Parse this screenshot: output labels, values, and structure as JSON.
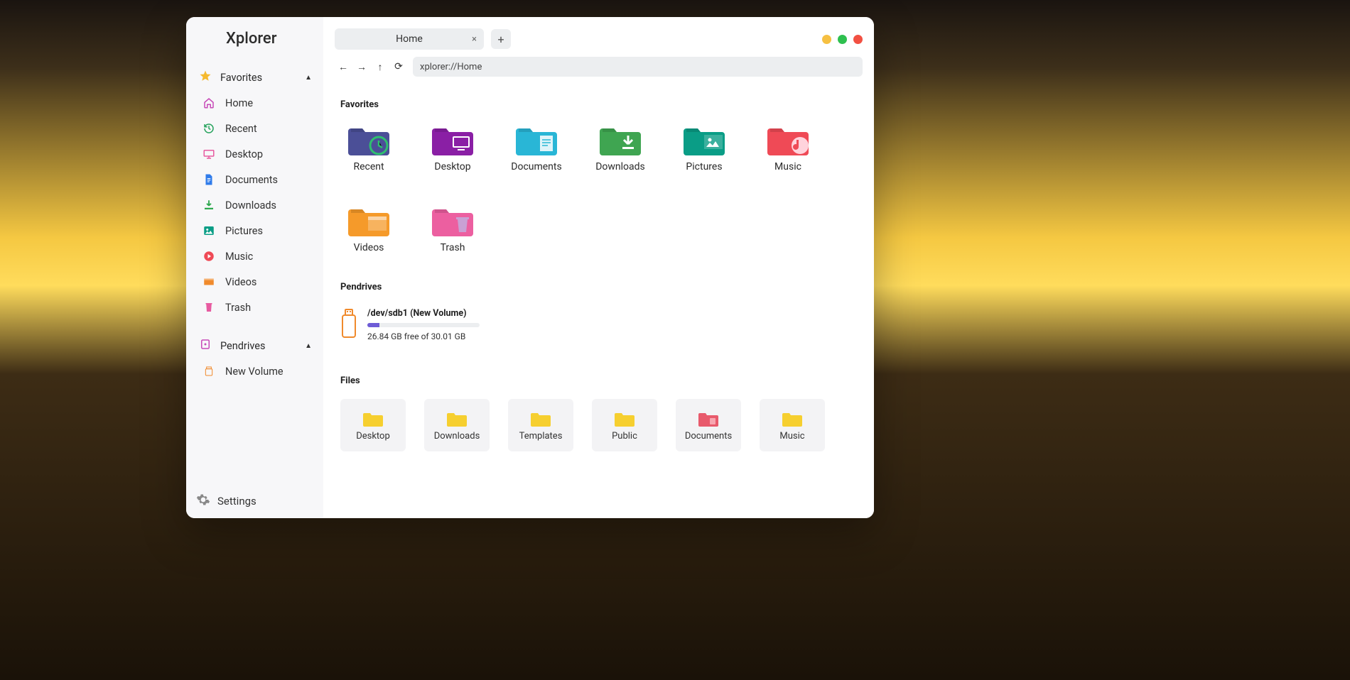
{
  "app": {
    "title": "Xplorer"
  },
  "window_controls": {
    "minimize": "yellow",
    "maximize": "green",
    "close": "red"
  },
  "tabs": [
    {
      "label": "Home",
      "closeGlyph": "×"
    }
  ],
  "newtab_glyph": "+",
  "nav": {
    "back": "←",
    "forward": "→",
    "up": "↑",
    "reload": "⟳",
    "address": "xplorer://Home"
  },
  "sidebar": {
    "sections": [
      {
        "key": "favorites",
        "title": "Favorites",
        "icon": "star-icon",
        "items": [
          {
            "label": "Home",
            "icon": "home-icon"
          },
          {
            "label": "Recent",
            "icon": "recent-icon"
          },
          {
            "label": "Desktop",
            "icon": "desktop-icon"
          },
          {
            "label": "Documents",
            "icon": "document-icon"
          },
          {
            "label": "Downloads",
            "icon": "download-icon"
          },
          {
            "label": "Pictures",
            "icon": "picture-icon"
          },
          {
            "label": "Music",
            "icon": "music-icon"
          },
          {
            "label": "Videos",
            "icon": "video-icon"
          },
          {
            "label": "Trash",
            "icon": "trash-icon"
          }
        ]
      },
      {
        "key": "pendrives",
        "title": "Pendrives",
        "icon": "usb-section-icon",
        "items": [
          {
            "label": "New Volume",
            "icon": "usb-icon"
          }
        ]
      }
    ]
  },
  "settings_label": "Settings",
  "content": {
    "favorites": {
      "title": "Favorites",
      "items": [
        {
          "label": "Recent",
          "color": "#4b4f97",
          "overlay": "recent"
        },
        {
          "label": "Desktop",
          "color": "#8a1fa5",
          "overlay": "desktop"
        },
        {
          "label": "Documents",
          "color": "#29b6d6",
          "overlay": "document"
        },
        {
          "label": "Downloads",
          "color": "#3fa551",
          "overlay": "download"
        },
        {
          "label": "Pictures",
          "color": "#0a9d86",
          "overlay": "picture"
        },
        {
          "label": "Music",
          "color": "#ef4a56",
          "overlay": "music"
        },
        {
          "label": "Videos",
          "color": "#f59a2a",
          "overlay": "video"
        },
        {
          "label": "Trash",
          "color": "#ec5fa0",
          "overlay": "trash"
        }
      ]
    },
    "pendrives": {
      "title": "Pendrives",
      "items": [
        {
          "name": "/dev/sdb1 (New Volume)",
          "usedPct": 10.6,
          "free": "26.84 GB free of 30.01 GB"
        }
      ]
    },
    "files": {
      "title": "Files",
      "items": [
        {
          "label": "Desktop",
          "color": "#f6cf2f"
        },
        {
          "label": "Downloads",
          "color": "#f6cf2f"
        },
        {
          "label": "Templates",
          "color": "#f6cf2f"
        },
        {
          "label": "Public",
          "color": "#f6cf2f"
        },
        {
          "label": "Documents",
          "color": "#e85a6c"
        },
        {
          "label": "Music",
          "color": "#f6cf2f"
        }
      ]
    }
  }
}
